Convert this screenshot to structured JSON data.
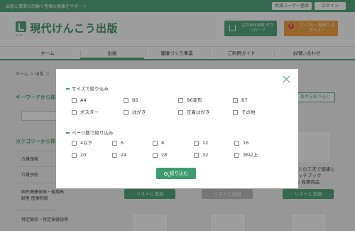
{
  "topbar": {
    "tagline": "出版と事業の両輪で皆様の健康をサポート",
    "register_label": "新規ユーザー登録",
    "login_label": "ログイン"
  },
  "header": {
    "logo_text": "現代けんこう出版",
    "logo_subtext": "gendai",
    "fax_button_label": "注文FAX用紙 ダウンロード",
    "sample_button_label": "サンプル・見積り 注文リスト",
    "sample_badge_count": "2"
  },
  "nav": {
    "items": [
      {
        "label": "ホーム"
      },
      {
        "label": "出版"
      },
      {
        "label": "健康づくり事業"
      },
      {
        "label": "ご利用ガイド"
      },
      {
        "label": "お問い合わせ"
      }
    ],
    "active_index": 1
  },
  "page": {
    "breadcrumb": "ホーム ＞ 出版 ＞",
    "keyword_search_title": "キーワードから探",
    "category_search_title": "カテゴリーから探",
    "categories": [
      "介護保険",
      "介護予防",
      "国民健康保険・後期高齢者 医療制度",
      "特定健診・特定保健指導"
    ],
    "filter_button_label": "条件を絞り込む",
    "product_text_line1": "との工夫で健康に",
    "product_text_line2": "ッチブック",
    "product_text_line3": "/ 見積商品",
    "cart_buttons": [
      {
        "label": "リストに追加",
        "disabled": false
      },
      {
        "label": "リストに追加",
        "disabled": true
      },
      {
        "label": "リストに追加",
        "disabled": false
      }
    ]
  },
  "modal": {
    "size_section_title": "サイズで絞り込み",
    "size_options": [
      "A4",
      "B5",
      "B6変形",
      "B7",
      "ポスター",
      "はがき",
      "圧着はがき",
      "その他"
    ],
    "pages_section_title": "ページ数で絞り込み",
    "page_options": [
      "4以下",
      "6",
      "8",
      "12",
      "16",
      "20",
      "24",
      "28",
      "32",
      "36以上"
    ],
    "submit_label": "絞り込む"
  },
  "colors": {
    "brand_green": "#3e9d70",
    "accent_orange": "#f29a2e",
    "badge_red": "#e83d3d"
  }
}
